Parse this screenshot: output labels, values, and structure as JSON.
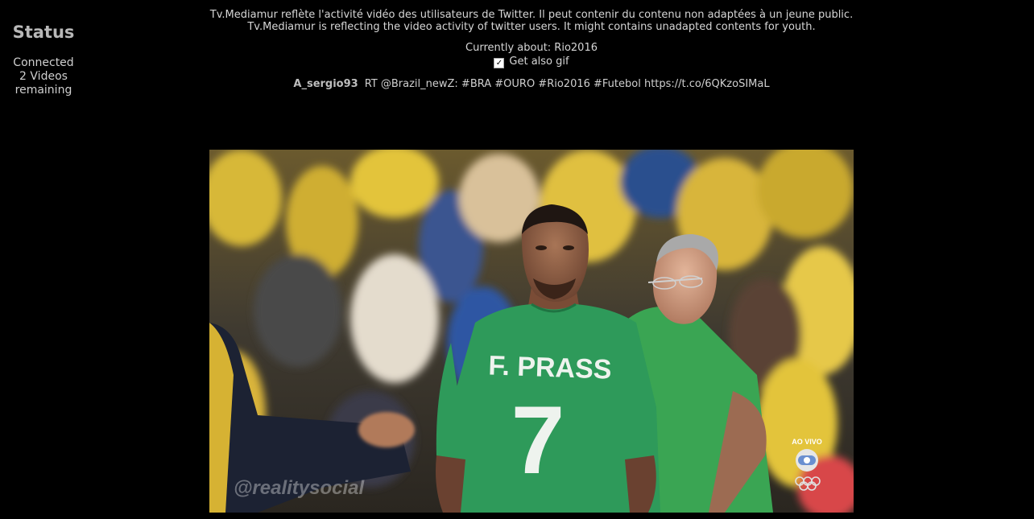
{
  "status": {
    "title": "Status",
    "connection": "Connected",
    "videos_count": "2 Videos",
    "remaining": "remaining"
  },
  "disclaimer": {
    "fr": "Tv.Mediamur reflète l'activité vidéo des utilisateurs de Twitter. Il peut contenir du contenu non adaptées à un jeune public.",
    "en": "Tv.Mediamur is reflecting the video activity of twitter users. It might contains unadapted contents for youth."
  },
  "topic": {
    "text": "Currently about: Rio2016"
  },
  "gif_option": {
    "checked": true,
    "label": "Get also gif"
  },
  "tweet": {
    "user": "A_sergio93",
    "text": "RT @Brazil_newZ: #BRA #OURO #Rio2016 #Futebol https://t.co/6QKzoSIMaL"
  },
  "video": {
    "jersey_name": "F. PRASS",
    "jersey_number": "7",
    "watermark": "@realitysocial",
    "broadcast_label": "AO VIVO",
    "colors": {
      "jersey": "#2e9a5a",
      "crowd_yellow": "#e3c43a",
      "crowd_blue": "#2a4f8e"
    }
  }
}
